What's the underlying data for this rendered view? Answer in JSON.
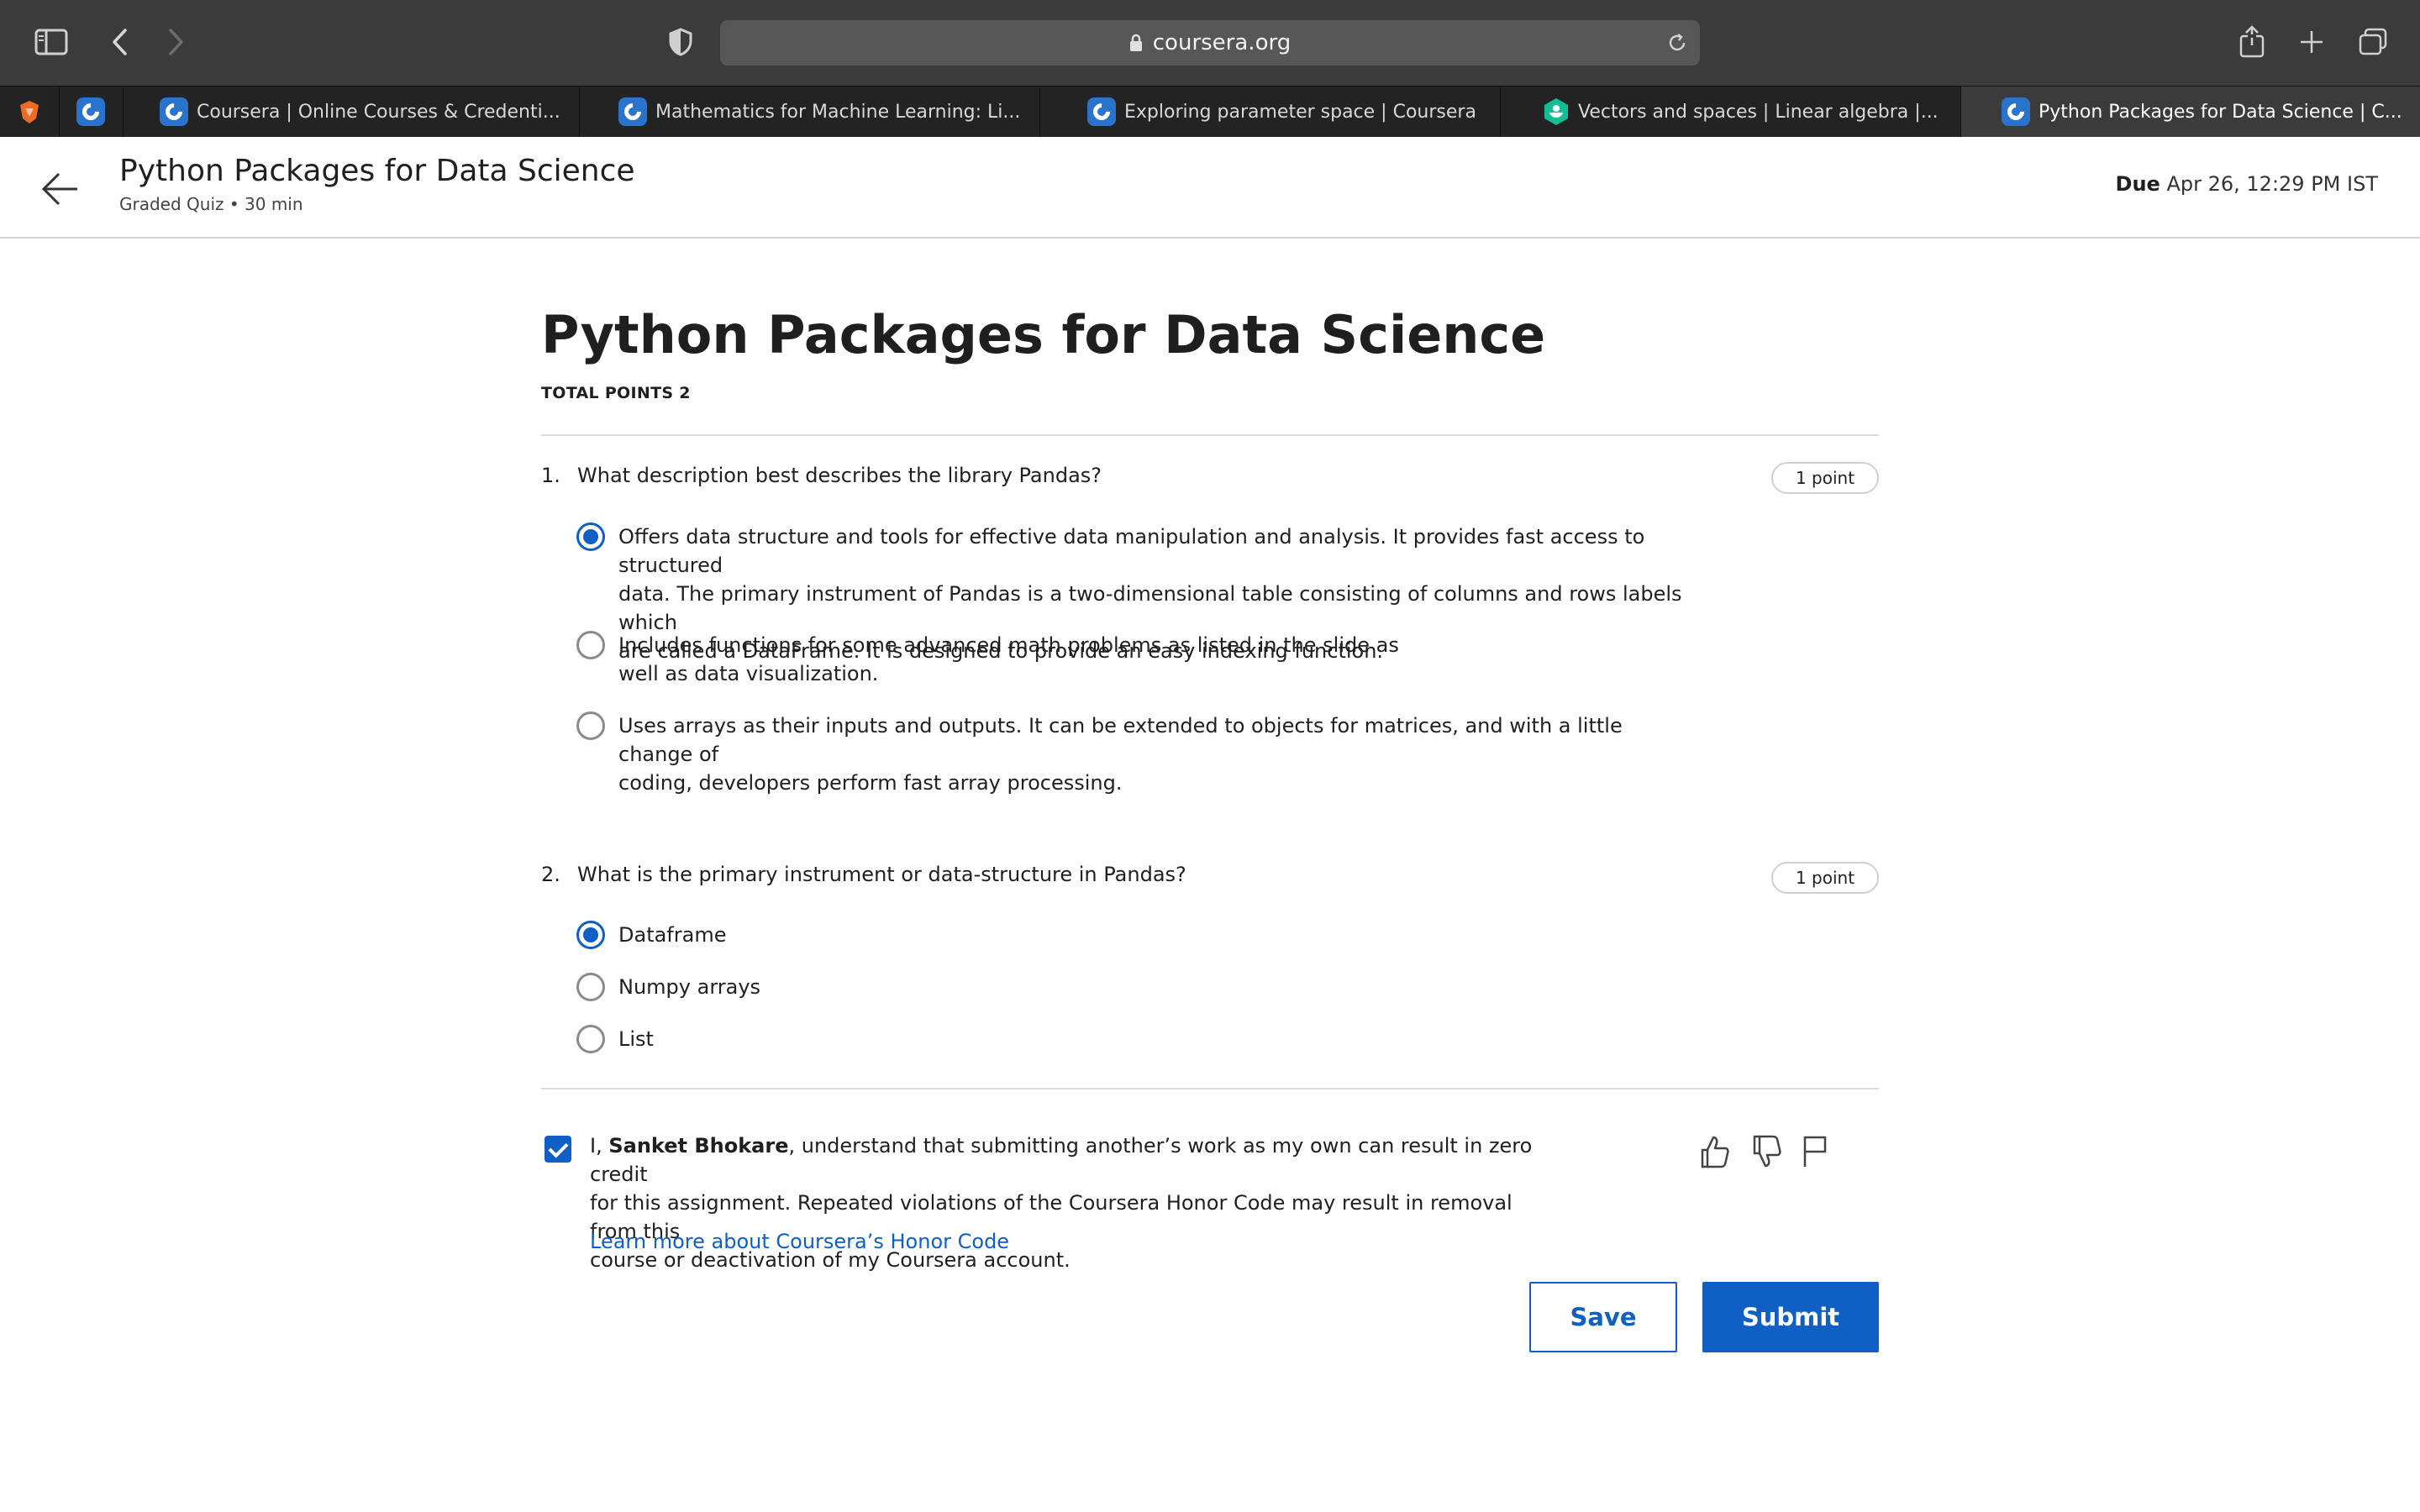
{
  "browser": {
    "url": "coursera.org",
    "tabs": [
      {
        "label": "Coursera | Online Courses & Credenti...",
        "icon": "coursera-favicon"
      },
      {
        "label": "Mathematics for Machine Learning: Li...",
        "icon": "coursera-favicon"
      },
      {
        "label": "Exploring parameter space | Coursera",
        "icon": "coursera-favicon"
      },
      {
        "label": "Vectors and spaces | Linear algebra |...",
        "icon": "khan-academy-favicon"
      },
      {
        "label": "Python Packages for Data Science | C...",
        "icon": "coursera-favicon",
        "active": true
      }
    ]
  },
  "header": {
    "title": "Python Packages for Data Science",
    "subtitle": "Graded Quiz • 30 min",
    "due_label": "Due",
    "due_value": "Apr 26, 12:29 PM IST"
  },
  "quiz": {
    "title": "Python Packages for Data Science",
    "total_points": "TOTAL POINTS 2",
    "questions": [
      {
        "number": "1.",
        "text": "What description best describes the library Pandas?",
        "points": "1 point",
        "options": [
          {
            "line1": "Offers data structure and tools for effective data manipulation and analysis. It provides fast access to structured",
            "line2": "data. The primary instrument of Pandas is a two-dimensional table consisting of columns and rows labels which",
            "line3": "are called a DataFrame. It is designed to provide an  easy indexing function.",
            "selected": true
          },
          {
            "line1": "Includes functions for some advanced math problems as listed in the slide as",
            "line2": "well as data visualization.",
            "selected": false
          },
          {
            "line1": "Uses arrays as their inputs and outputs. It can be extended to objects for matrices, and with a little change of",
            "line2": "coding, developers perform fast array processing.",
            "selected": false
          }
        ]
      },
      {
        "number": "2.",
        "text": "What is the primary instrument or data-structure in Pandas?",
        "points": "1 point",
        "options": [
          {
            "line1": "Dataframe",
            "selected": true
          },
          {
            "line1": "Numpy arrays",
            "selected": false
          },
          {
            "line1": "List",
            "selected": false
          }
        ]
      }
    ]
  },
  "honor_code": {
    "checked": true,
    "prefix": "I, ",
    "name": "Sanket Bhokare",
    "line1_rest": ", understand that submitting another’s work as my own can result in zero credit",
    "line2": "for this assignment. Repeated violations of the Coursera Honor Code may result in removal from this",
    "line3": "course or deactivation of my Coursera account.",
    "link": "Learn more about Coursera’s Honor Code"
  },
  "actions": {
    "save": "Save",
    "submit": "Submit"
  },
  "colors": {
    "accent": "#0f5fc4",
    "toolbar": "#3b3b3c",
    "tabbar": "#232324"
  }
}
